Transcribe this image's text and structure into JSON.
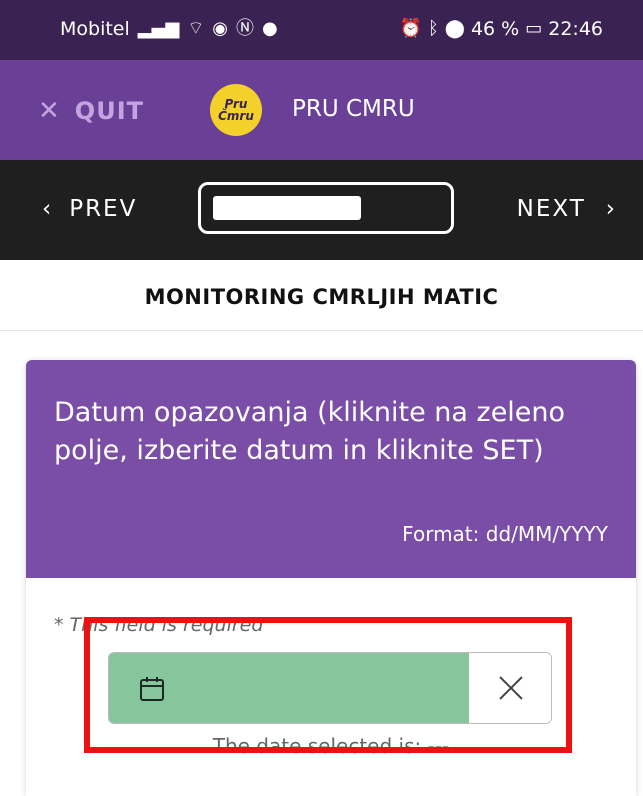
{
  "status_bar": {
    "carrier": "Mobitel",
    "battery": "46 %",
    "time": "22:46",
    "icons": [
      "signal-icon",
      "wifi-icon",
      "eye-icon",
      "nfc-icon",
      "messenger-icon",
      "alarm-icon",
      "bluetooth-icon",
      "location-icon",
      "battery-icon"
    ]
  },
  "app_bar": {
    "quit_label": "QUIT",
    "logo_text": "Pru Čmru",
    "title": "PRU CMRU"
  },
  "nav": {
    "prev_label": "PREV",
    "next_label": "NEXT"
  },
  "section": {
    "title": "MONITORING CMRLJIH MATIC"
  },
  "question": {
    "label": "Datum opazovanja (kliknite na zeleno polje, izberite datum in kliknite SET)",
    "format": "Format: dd/MM/YYYY",
    "required_note": "* This field is required",
    "selected_text": "The date selected is: ---"
  },
  "colors": {
    "status_bar": "#3a2352",
    "app_bar": "#6a3f96",
    "nav_bar": "#1f1f1f",
    "card_head": "#7a4ea6",
    "date_field": "#87c59c",
    "highlight": "#ee1111",
    "logo": "#f3d02a"
  }
}
